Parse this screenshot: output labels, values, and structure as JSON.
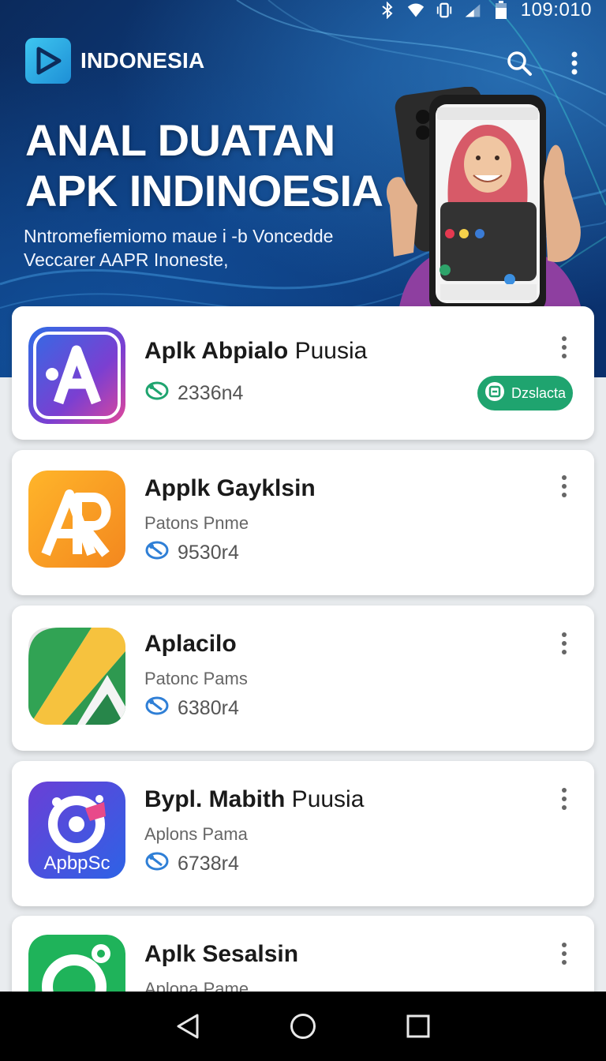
{
  "status_bar": {
    "time": "109:010"
  },
  "header": {
    "brand": "INDONESIA",
    "headline_line1": "ANAL DUATAN",
    "headline_line2": "APK INDINOESIA",
    "subtitle_line1": "Nntromefiemiomo maue i -b Voncedde",
    "subtitle_line2": "Veccarer AAPR Inoneste,"
  },
  "apps": [
    {
      "title_bold": "Aplk Abpialo",
      "title_rest": " Puusia",
      "subtitle": "",
      "count": "2336n4",
      "action_label": "Dzslacta"
    },
    {
      "title_bold": "Applk Gayklsin",
      "title_rest": "",
      "subtitle": "Patons Pnme",
      "count": "9530r4"
    },
    {
      "title_bold": "Aplacilo",
      "title_rest": "",
      "subtitle": "Patonc Pams",
      "count": "6380r4"
    },
    {
      "title_bold": "Bypl. Mabith",
      "title_rest": " Puusia",
      "subtitle": "Aplons Pama",
      "count": "6738r4",
      "icon_text": "ApbpSc"
    },
    {
      "title_bold": "Aplk Sesalsin",
      "title_rest": "",
      "subtitle": "Aplona Pame"
    }
  ],
  "colors": {
    "accent_green": "#1fa46f",
    "hero_blue": "#0e3f82",
    "nav_bar": "#000000"
  },
  "icons": {
    "status": [
      "bluetooth-icon",
      "wifi-icon",
      "vibrate-icon",
      "signal-icon",
      "battery-icon"
    ],
    "header": [
      "search-icon",
      "more-vert-icon"
    ],
    "nav": [
      "back-icon",
      "home-icon",
      "recents-icon"
    ]
  }
}
